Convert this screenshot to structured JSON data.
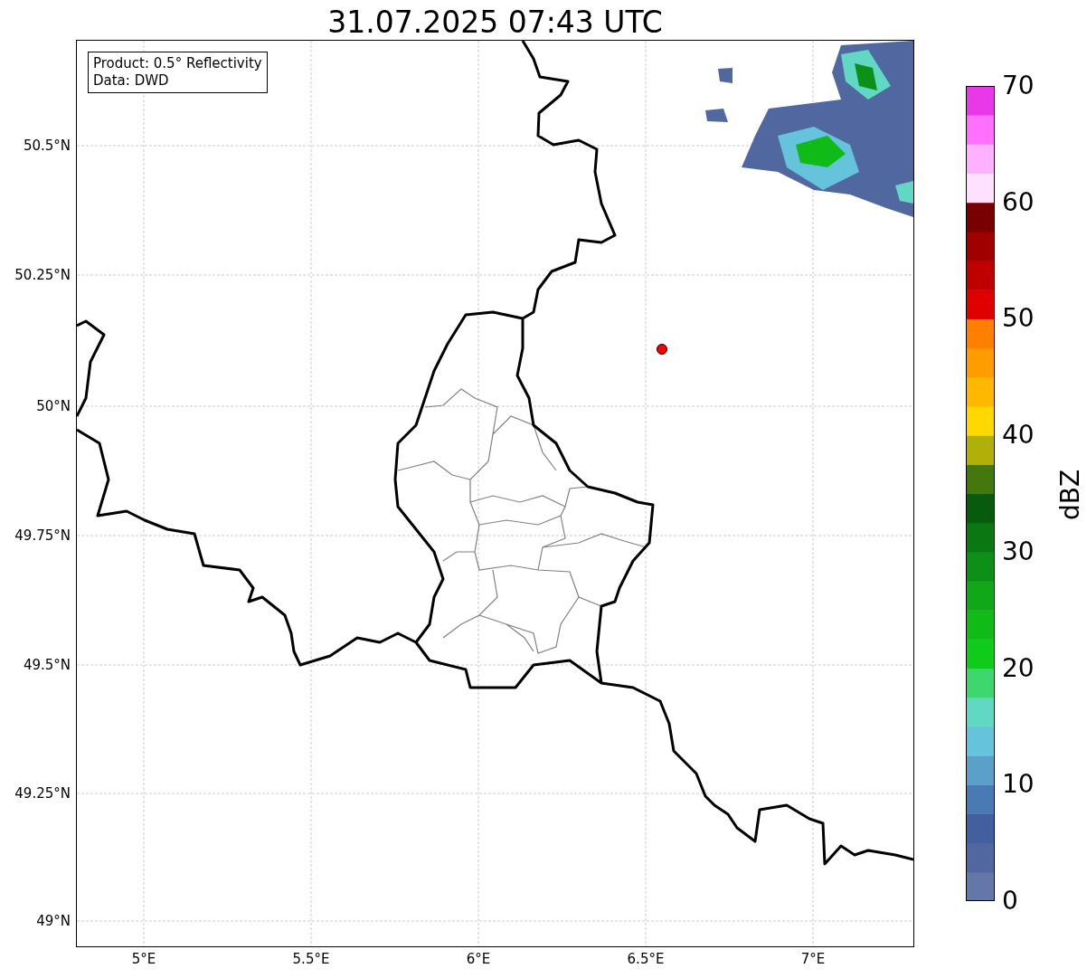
{
  "title": "31.07.2025 07:43 UTC",
  "info_box": {
    "lines": [
      "Product: 0.5° Reflectivity",
      "Data: DWD"
    ]
  },
  "map": {
    "y_labels": [
      "50.5°N",
      "50.25°N",
      "50°N",
      "49.75°N",
      "49.5°N",
      "49.25°N",
      "49°N"
    ],
    "x_labels": [
      "5°E",
      "5.5°E",
      "6°E",
      "6.5°E",
      "7°E"
    ]
  },
  "colorbar": {
    "label": "dBZ",
    "ticks": [
      "70",
      "60",
      "50",
      "40",
      "30",
      "20",
      "10",
      "0"
    ],
    "bands": [
      {
        "color": "#6577a8"
      },
      {
        "color": "#5067a0"
      },
      {
        "color": "#4260a0"
      },
      {
        "color": "#4a7ab4"
      },
      {
        "color": "#5aa0c8"
      },
      {
        "color": "#66c3dc"
      },
      {
        "color": "#60d8c4"
      },
      {
        "color": "#3ed66e"
      },
      {
        "color": "#10cc1a"
      },
      {
        "color": "#10bb18"
      },
      {
        "color": "#10a818"
      },
      {
        "color": "#0c9018"
      },
      {
        "color": "#0a7812"
      },
      {
        "color": "#065c0c"
      },
      {
        "color": "#45780c"
      },
      {
        "color": "#b0b008"
      },
      {
        "color": "#ffd800"
      },
      {
        "color": "#ffb800"
      },
      {
        "color": "#ff9c00"
      },
      {
        "color": "#ff8000"
      },
      {
        "color": "#e00000"
      },
      {
        "color": "#c00000"
      },
      {
        "color": "#a00000"
      },
      {
        "color": "#780000"
      },
      {
        "color": "#ffe0ff"
      },
      {
        "color": "#ffb0ff"
      },
      {
        "color": "#ff70ff"
      },
      {
        "color": "#e838e8"
      }
    ]
  }
}
